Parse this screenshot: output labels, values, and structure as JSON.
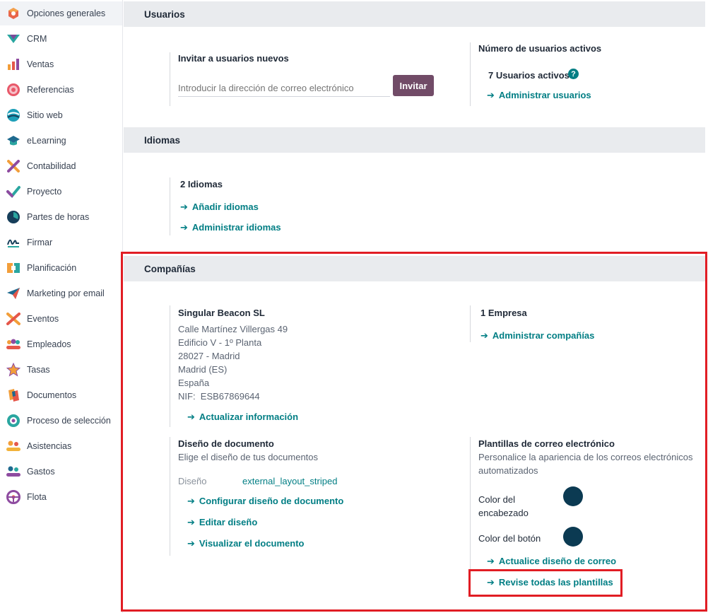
{
  "sidebar": {
    "items": [
      {
        "label": "Opciones generales",
        "icon": "settings-icon"
      },
      {
        "label": "CRM",
        "icon": "crm-icon"
      },
      {
        "label": "Ventas",
        "icon": "sales-icon"
      },
      {
        "label": "Referencias",
        "icon": "referrals-icon"
      },
      {
        "label": "Sitio web",
        "icon": "website-icon"
      },
      {
        "label": "eLearning",
        "icon": "elearning-icon"
      },
      {
        "label": "Contabilidad",
        "icon": "accounting-icon"
      },
      {
        "label": "Proyecto",
        "icon": "project-icon"
      },
      {
        "label": "Partes de horas",
        "icon": "timesheets-icon"
      },
      {
        "label": "Firmar",
        "icon": "sign-icon"
      },
      {
        "label": "Planificación",
        "icon": "planning-icon"
      },
      {
        "label": "Marketing por email",
        "icon": "email-marketing-icon"
      },
      {
        "label": "Eventos",
        "icon": "events-icon"
      },
      {
        "label": "Empleados",
        "icon": "employees-icon"
      },
      {
        "label": "Tasas",
        "icon": "appraisals-icon"
      },
      {
        "label": "Documentos",
        "icon": "documents-icon"
      },
      {
        "label": "Proceso de selección",
        "icon": "recruitment-icon"
      },
      {
        "label": "Asistencias",
        "icon": "attendances-icon"
      },
      {
        "label": "Gastos",
        "icon": "expenses-icon"
      },
      {
        "label": "Flota",
        "icon": "fleet-icon"
      }
    ]
  },
  "users": {
    "section_title": "Usuarios",
    "invite_title": "Invitar a usuarios nuevos",
    "email_placeholder": "Introducir la dirección de correo electrónico",
    "invite_button": "Invitar",
    "active_title": "Número de usuarios activos",
    "active_count": "7 Usuarios activos",
    "help": "?",
    "manage_users": "Administrar usuarios"
  },
  "languages": {
    "section_title": "Idiomas",
    "count": "2 Idiomas",
    "add": "Añadir idiomas",
    "manage": "Administrar idiomas"
  },
  "companies": {
    "section_title": "Compañías",
    "company_name": "Singular Beacon SL",
    "address_line1": "Calle Martínez Villergas 49",
    "address_line2": "Edificio V - 1º Planta",
    "address_line3": "28027 - Madrid",
    "address_line4": "Madrid (ES)",
    "address_line5": "España",
    "vat": "NIF:  ESB67869644",
    "update_info": "Actualizar información",
    "company_count": "1 Empresa",
    "manage_companies": "Administrar compañías",
    "doc_layout_title": "Diseño de documento",
    "doc_layout_desc": "Elige el diseño de tus documentos",
    "layout_label": "Diseño",
    "layout_value": "external_layout_striped",
    "configure_layout": "Configurar diseño de documento",
    "edit_layout": "Editar diseño",
    "preview_document": "Visualizar el documento",
    "email_templates_title": "Plantillas de correo electrónico",
    "email_templates_desc1": "Personalice la apariencia de los correos electrónicos",
    "email_templates_desc2": "automatizados",
    "header_color_label1": "Color del",
    "header_color_label2": "encabezado",
    "header_color": "#0b3a52",
    "button_color_label": "Color del botón",
    "button_color": "#0b3a52",
    "update_mail_layout": "Actualice diseño de correo",
    "review_templates": "Revise todas las plantillas"
  },
  "colors": {
    "accent": "#017e84",
    "brand": "#714b67",
    "highlight": "#e11d24"
  }
}
